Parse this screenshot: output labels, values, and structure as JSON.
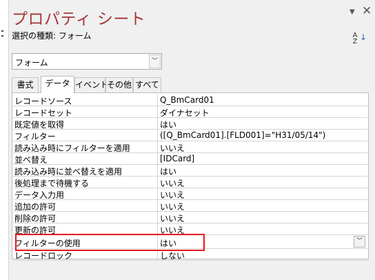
{
  "panel": {
    "title": "プロパティ シート",
    "selection_type": "選択の種類: フォーム",
    "sort_icon_text": "A Z"
  },
  "combo": {
    "value": "フォーム"
  },
  "tabs": [
    "書式",
    "データ",
    "イベント",
    "その他",
    "すべて"
  ],
  "active_tab": "データ",
  "rows": [
    {
      "label": "レコードソース",
      "value": "Q_BmCard01"
    },
    {
      "label": "レコードセット",
      "value": "ダイナセット"
    },
    {
      "label": "既定値を取得",
      "value": "はい"
    },
    {
      "label": "フィルター",
      "value": "([Q_BmCard01].[FLD001]=\"H31/05/14\")"
    },
    {
      "label": "読み込み時にフィルターを適用",
      "value": "いいえ"
    },
    {
      "label": "並べ替え",
      "value": "[IDCard]"
    },
    {
      "label": "読み込み時に並べ替えを適用",
      "value": "はい"
    },
    {
      "label": "後処理まで待機する",
      "value": "いいえ"
    },
    {
      "label": "データ入力用",
      "value": "いいえ"
    },
    {
      "label": "追加の許可",
      "value": "いいえ"
    },
    {
      "label": "削除の許可",
      "value": "いいえ"
    },
    {
      "label": "更新の許可",
      "value": "いいえ"
    },
    {
      "label": "フィルターの使用",
      "value": "はい"
    },
    {
      "label": "レコードロック",
      "value": "しない"
    }
  ],
  "selected_row": "フィルターの使用",
  "highlight_color": "#e8141b",
  "title_color": "#a5373a"
}
